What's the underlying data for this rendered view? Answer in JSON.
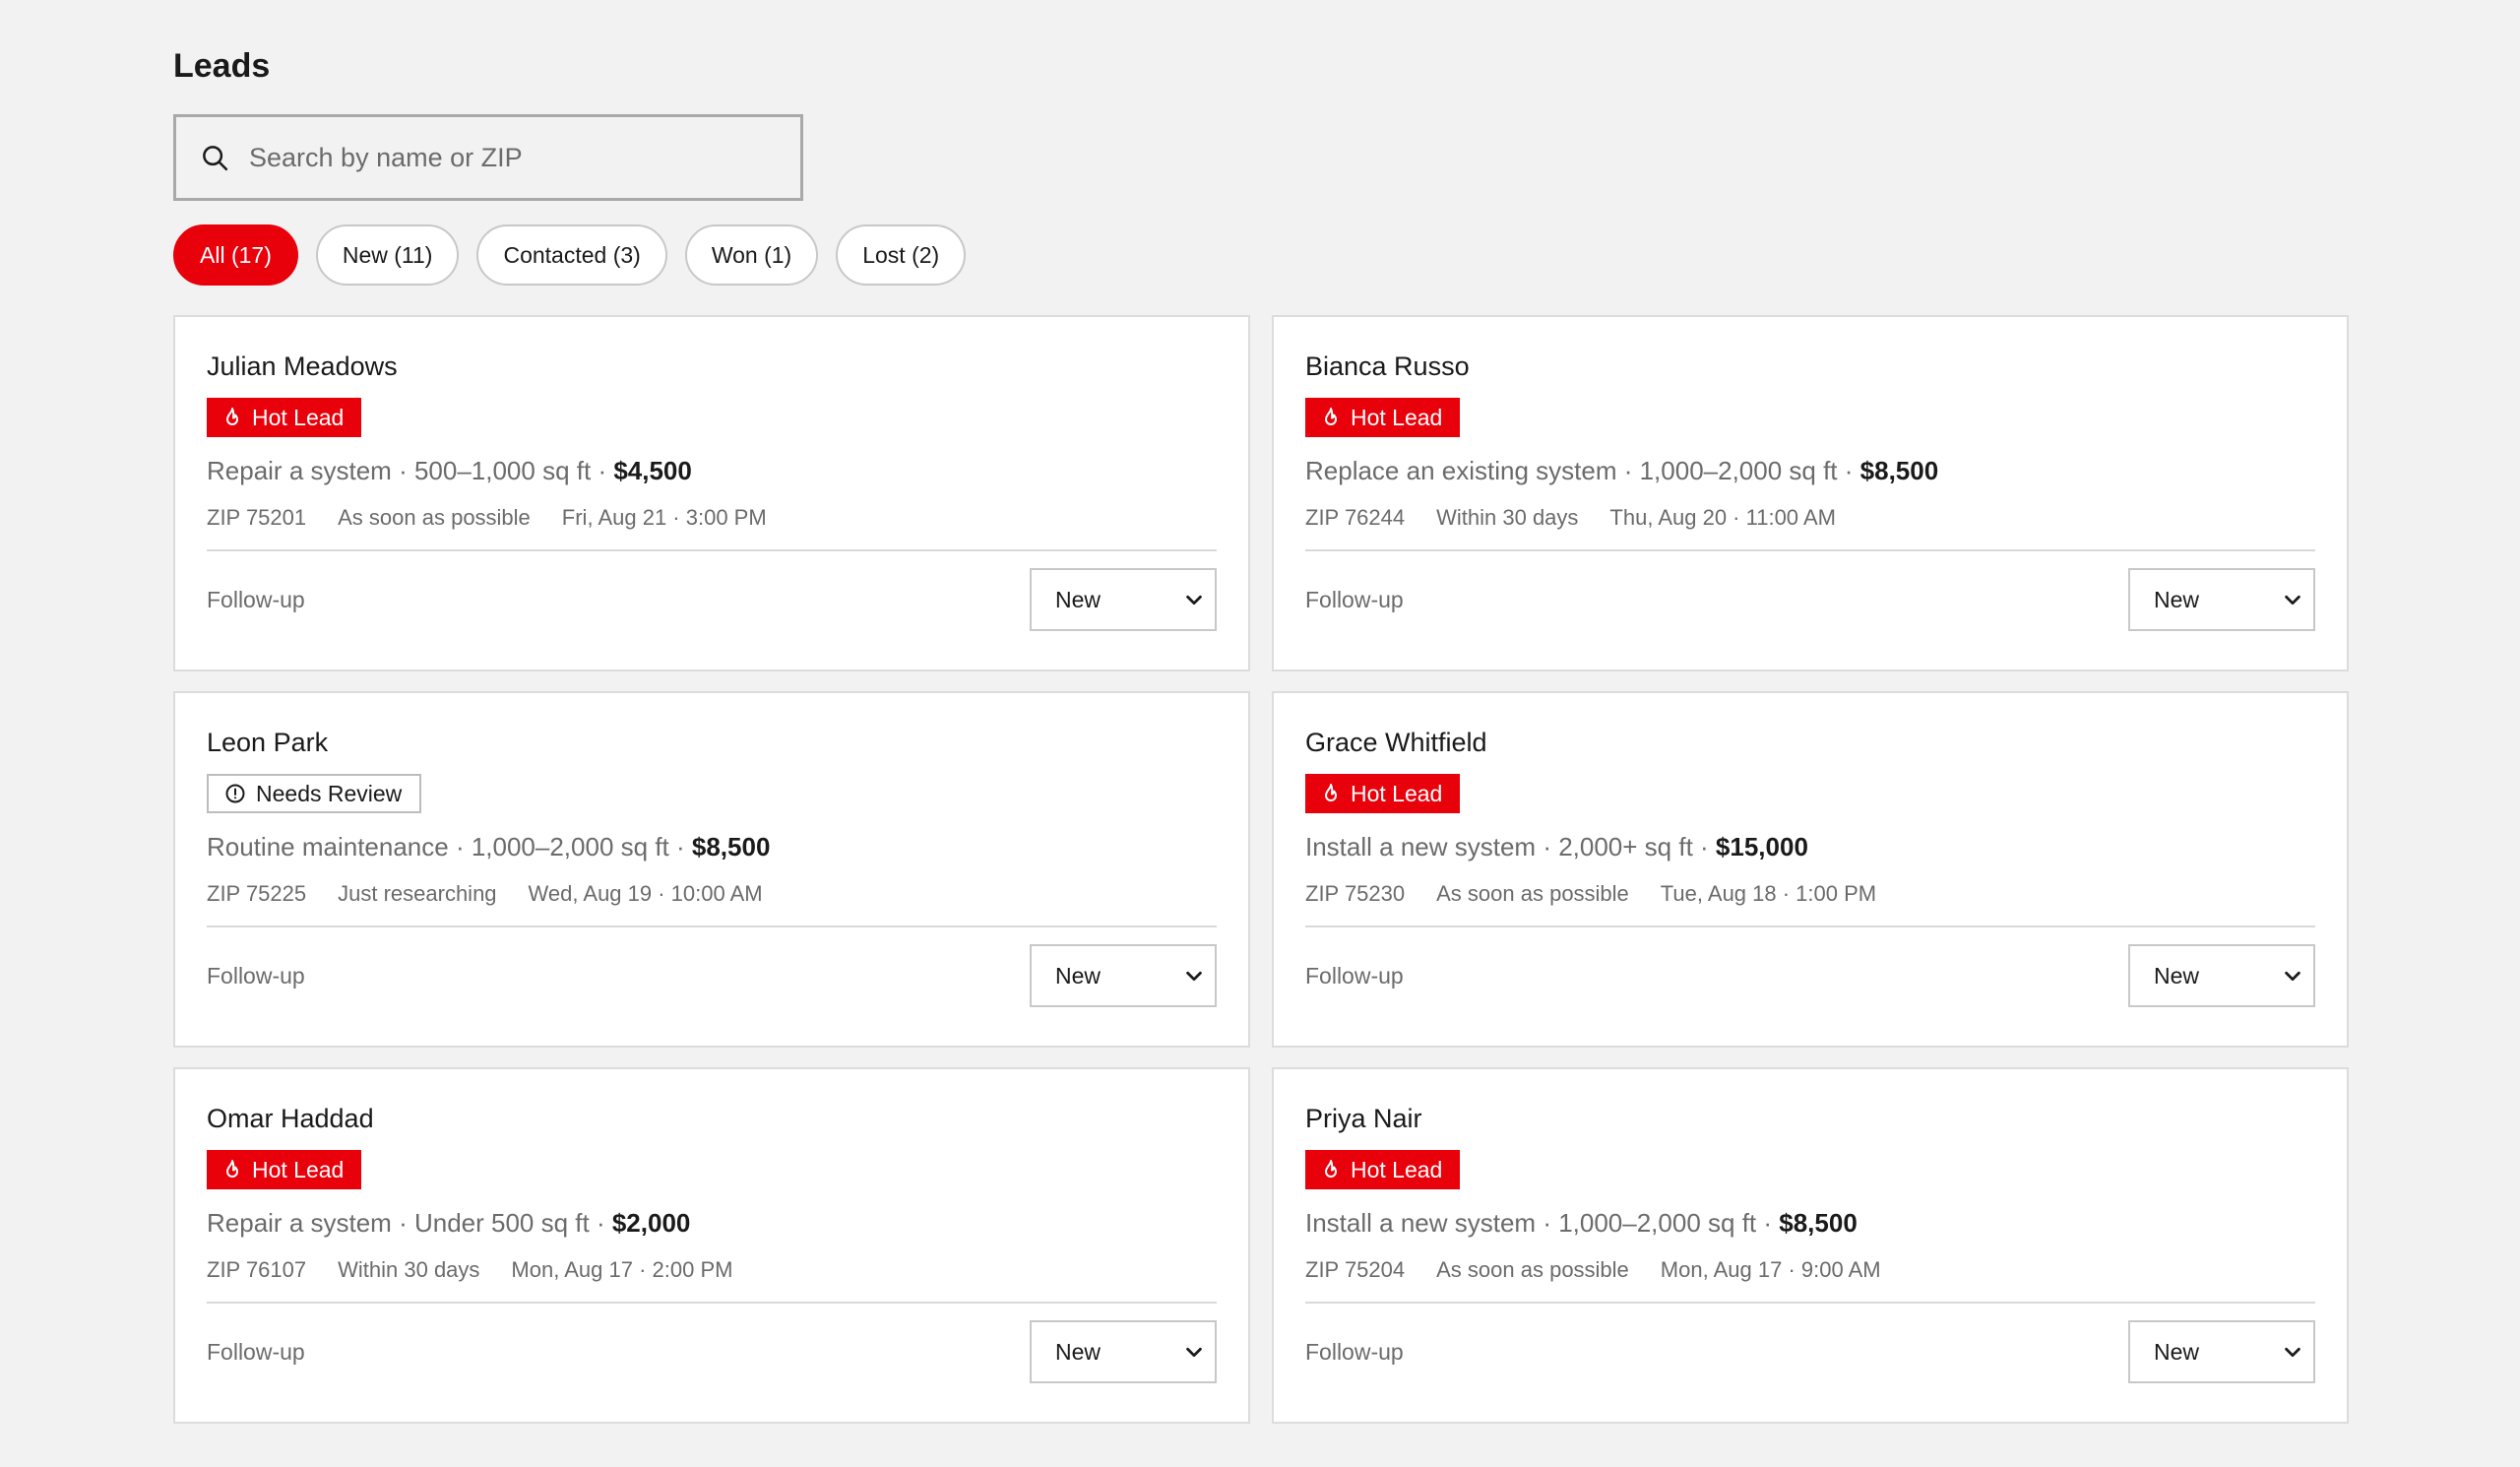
{
  "header": {
    "title": "Leads"
  },
  "search": {
    "placeholder": "Search by name or ZIP"
  },
  "filters": [
    {
      "label": "All (17)",
      "active": true
    },
    {
      "label": "New (11)",
      "active": false
    },
    {
      "label": "Contacted (3)",
      "active": false
    },
    {
      "label": "Won (1)",
      "active": false
    },
    {
      "label": "Lost (2)",
      "active": false
    }
  ],
  "colors": {
    "accent": "#e8000b",
    "background": "#f2f2f2",
    "card": "#ffffff",
    "muted_text": "#6b6b6b"
  },
  "leads": [
    {
      "name": "Julian Meadows",
      "badge": "Hot Lead",
      "badge_type": "hot",
      "badge_icon": "flame-icon",
      "service": "Repair a system",
      "size": "500–1,000 sq ft",
      "price": "$4,500",
      "zip": "ZIP 75201",
      "timeline": "As soon as possible",
      "date": "Fri, Aug 21 · 3:00 PM",
      "followup": "Follow-up",
      "status": "New"
    },
    {
      "name": "Bianca Russo",
      "badge": "Hot Lead",
      "badge_type": "hot",
      "badge_icon": "flame-icon",
      "service": "Replace an existing system",
      "size": "1,000–2,000 sq ft",
      "price": "$8,500",
      "zip": "ZIP 76244",
      "timeline": "Within 30 days",
      "date": "Thu, Aug 20 · 11:00 AM",
      "followup": "Follow-up",
      "status": "New"
    },
    {
      "name": "Leon Park",
      "badge": "Needs Review",
      "badge_type": "review",
      "badge_icon": "alert-circle-icon",
      "service": "Routine maintenance",
      "size": "1,000–2,000 sq ft",
      "price": "$8,500",
      "zip": "ZIP 75225",
      "timeline": "Just researching",
      "date": "Wed, Aug 19 · 10:00 AM",
      "followup": "Follow-up",
      "status": "New"
    },
    {
      "name": "Grace Whitfield",
      "badge": "Hot Lead",
      "badge_type": "hot",
      "badge_icon": "flame-icon",
      "service": "Install a new system",
      "size": "2,000+ sq ft",
      "price": "$15,000",
      "zip": "ZIP 75230",
      "timeline": "As soon as possible",
      "date": "Tue, Aug 18 · 1:00 PM",
      "followup": "Follow-up",
      "status": "New"
    },
    {
      "name": "Omar Haddad",
      "badge": "Hot Lead",
      "badge_type": "hot",
      "badge_icon": "flame-icon",
      "service": "Repair a system",
      "size": "Under 500 sq ft",
      "price": "$2,000",
      "zip": "ZIP 76107",
      "timeline": "Within 30 days",
      "date": "Mon, Aug 17 · 2:00 PM",
      "followup": "Follow-up",
      "status": "New"
    },
    {
      "name": "Priya Nair",
      "badge": "Hot Lead",
      "badge_type": "hot",
      "badge_icon": "flame-icon",
      "service": "Install a new system",
      "size": "1,000–2,000 sq ft",
      "price": "$8,500",
      "zip": "ZIP 75204",
      "timeline": "As soon as possible",
      "date": "Mon, Aug 17 · 9:00 AM",
      "followup": "Follow-up",
      "status": "New"
    }
  ]
}
